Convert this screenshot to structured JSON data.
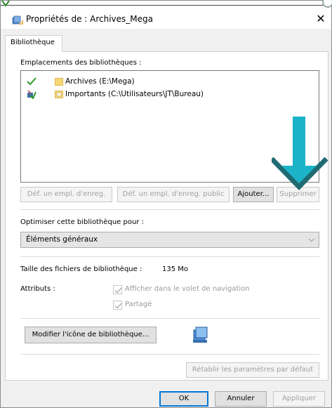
{
  "window": {
    "title": "Propriétés de : Archives_Mega",
    "close_glyph": "✕"
  },
  "tabs": [
    {
      "label": "Bibliothèque",
      "selected": true
    }
  ],
  "locations": {
    "label": "Emplacements des bibliothèques :",
    "items": [
      {
        "state_icon": "checkmark-icon",
        "folder_icon": "folder-icon",
        "text": "Archives (E:\\Mega)"
      },
      {
        "state_icon": "network-folder-icon",
        "folder_icon": "folder-icon",
        "text": "Importants (C:\\Utilisateurs\\JT\\Bureau)"
      }
    ]
  },
  "buttons": {
    "set_save_location": "Déf. un empl. d'enreg.",
    "set_public_save_location": "Déf. un empl. d'enreg. public",
    "add": "Ajouter...",
    "remove": "Supprimer"
  },
  "optimize": {
    "label": "Optimiser cette bibliothèque pour :",
    "selected": "Éléments généraux",
    "chevron": "⌵"
  },
  "size": {
    "label": "Taille des fichiers de bibliothèque :",
    "value": "135 Mo"
  },
  "attributes": {
    "label": "Attributs :",
    "show_in_nav_label": "Afficher dans le volet de navigation",
    "shared_label": "Partagé"
  },
  "icon_section": {
    "change_icon_button": "Modifier l'icône de bibliothèque..."
  },
  "restore_defaults": "Rétablir les paramètres par défaut",
  "footer": {
    "ok": "OK",
    "cancel": "Annuler",
    "apply": "Appliquer"
  },
  "colors": {
    "accent": "#0078d7",
    "arrow_teal": "#1ab3c8"
  }
}
